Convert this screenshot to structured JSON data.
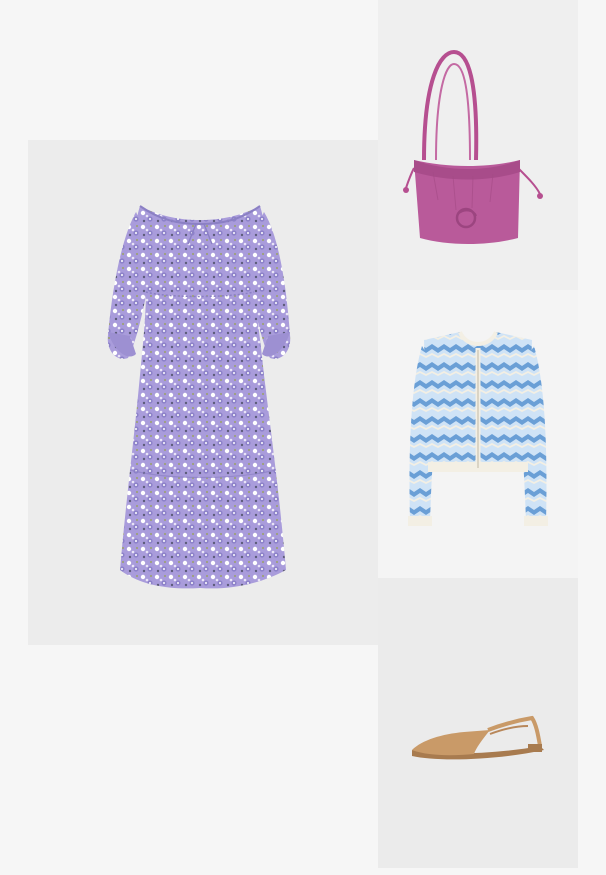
{
  "outfit": {
    "items": [
      {
        "product": "floral-midi-dress",
        "icon": "dress-icon",
        "colors": {
          "base": "#a79ad9",
          "flower": "#ffffff",
          "dark": "#5d5c7a",
          "leaf": "#9aa169"
        }
      },
      {
        "product": "drawstring-tote-bag",
        "icon": "bag-icon",
        "colors": {
          "body": "#b95a9a",
          "strap": "#b64f90"
        }
      },
      {
        "product": "striped-knit-cardigan",
        "icon": "cardigan-icon",
        "colors": {
          "blue": "#6a9fd6",
          "light": "#cfe3f6",
          "cream": "#f3efe4"
        }
      },
      {
        "product": "slingback-flat-shoe",
        "icon": "shoe-icon",
        "colors": {
          "suede": "#c99a68"
        }
      }
    ]
  }
}
